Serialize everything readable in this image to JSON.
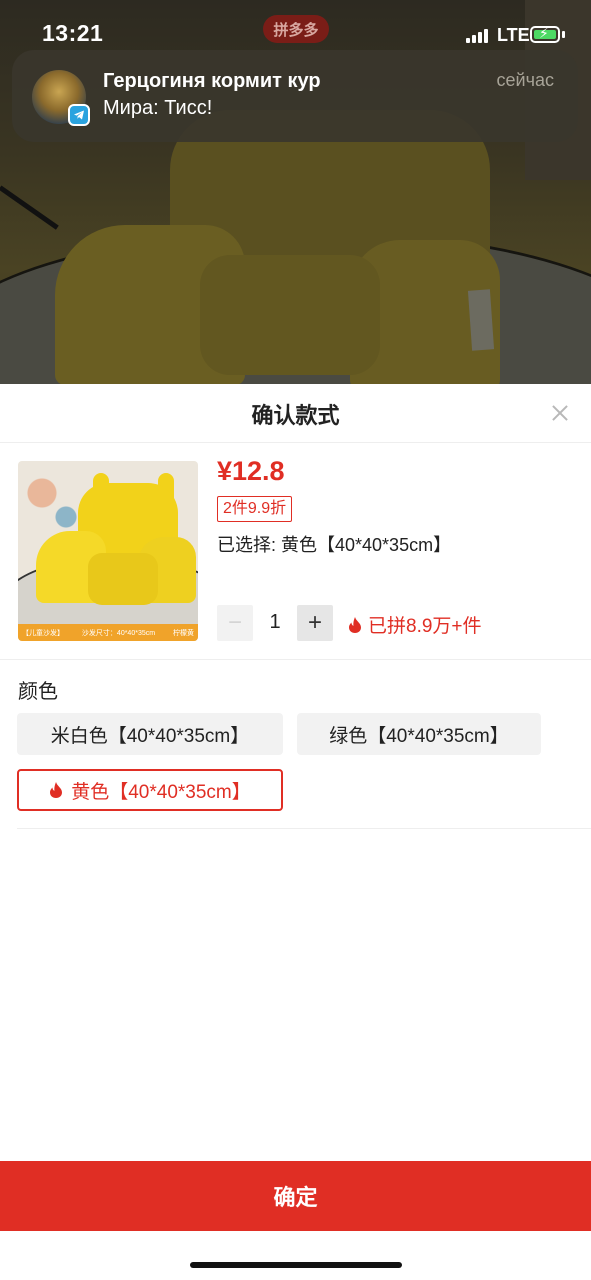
{
  "status_bar": {
    "time": "13:21",
    "network": "LTE"
  },
  "background": {
    "app_logo": "拼多多"
  },
  "notification": {
    "title": "Герцогиня кормит кур",
    "body": "Мира: Тисс!",
    "time": "сейчас",
    "app_icon": "telegram-icon"
  },
  "sheet": {
    "title": "确认款式",
    "product": {
      "price": "¥12.8",
      "discount": "2件9.9折",
      "selected": "已选择: 黄色【40*40*35cm】",
      "thumb_caption_left": "【儿童沙发】",
      "thumb_caption_mid": "沙发尺寸：40*40*35cm",
      "thumb_caption_right": "柠檬黄"
    },
    "quantity": {
      "value": "1",
      "minus": "−",
      "plus": "+"
    },
    "sold": "已拼8.9万+件",
    "color_label": "颜色",
    "options": [
      {
        "label": "米白色【40*40*35cm】",
        "selected": false
      },
      {
        "label": "绿色【40*40*35cm】",
        "selected": false
      },
      {
        "label": "黄色【40*40*35cm】",
        "selected": true
      }
    ],
    "confirm": "确定"
  },
  "colors": {
    "accent": "#e02e24",
    "option_bg": "#f2f2f2"
  }
}
